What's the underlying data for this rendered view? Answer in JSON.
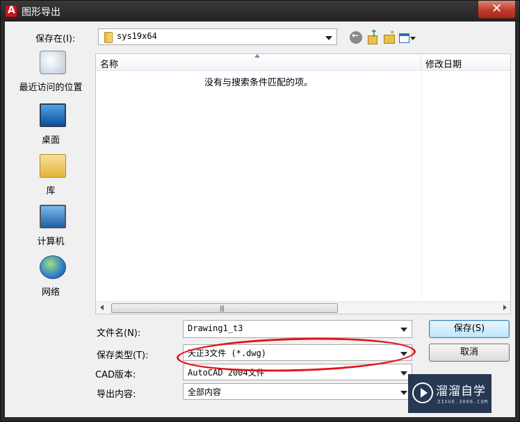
{
  "window": {
    "title": "图形导出",
    "close_glyph": "✕"
  },
  "toolbar": {
    "lookin_label": "保存在(I):",
    "lookin_value": "sys19x64"
  },
  "places": [
    {
      "label": "最近访问的位置",
      "icon": "recent-places-icon"
    },
    {
      "label": "桌面",
      "icon": "desktop-icon"
    },
    {
      "label": "库",
      "icon": "libraries-icon"
    },
    {
      "label": "计算机",
      "icon": "computer-icon"
    },
    {
      "label": "网络",
      "icon": "network-icon"
    }
  ],
  "filelist": {
    "columns": [
      "名称",
      "修改日期"
    ],
    "empty_message": "没有与搜索条件匹配的项。",
    "scroll_grip": "|||"
  },
  "form": {
    "filename_label": "文件名(N):",
    "filename_value": "Drawing1_t3",
    "filetype_label": "保存类型(T):",
    "filetype_value": "天正3文件 (*.dwg)",
    "cadversion_label": "CAD版本:",
    "cadversion_value": "AutoCAD 2004文件",
    "export_label": "导出内容:",
    "export_value": "全部内容"
  },
  "buttons": {
    "save": "保存(S)",
    "cancel": "取消"
  },
  "watermark": {
    "text": "溜溜自学",
    "sub": "ZIXUE.3066.COM"
  },
  "colors": {
    "annotation_circle": "#e3131b",
    "app_icon": "#c8161d"
  }
}
